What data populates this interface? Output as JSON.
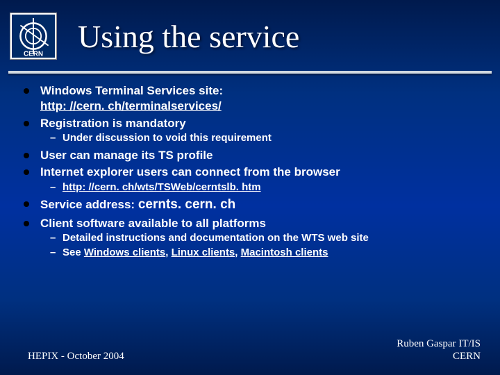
{
  "header": {
    "title": "Using the service"
  },
  "bullets": {
    "b0": {
      "text": "Windows Terminal Services site:",
      "link": "http: //cern. ch/terminalservices/"
    },
    "b1": {
      "text": "Registration is mandatory"
    },
    "b1_s0": "Under discussion to void this requirement",
    "b2": {
      "text": "User can manage its TS profile"
    },
    "b3": {
      "text": "Internet explorer users can connect from the browser"
    },
    "b3_s0_link": "http: //cern. ch/wts/TSWeb/cerntslb. htm",
    "b4": {
      "label": "Service address: ",
      "addr": "cernts. cern. ch"
    },
    "b5": {
      "text": "Client software available to all platforms"
    },
    "b5_s0": "Detailed instructions and documentation on the WTS web site",
    "b5_s1_prefix": "See ",
    "b5_s1_l0": "Windows clients",
    "b5_s1_l1": "Linux clients",
    "b5_s1_l2": "Macintosh clients"
  },
  "footer": {
    "left": "HEPIX - October 2004",
    "right1": "Ruben Gaspar IT/IS",
    "right2": "CERN"
  },
  "sep": ", "
}
